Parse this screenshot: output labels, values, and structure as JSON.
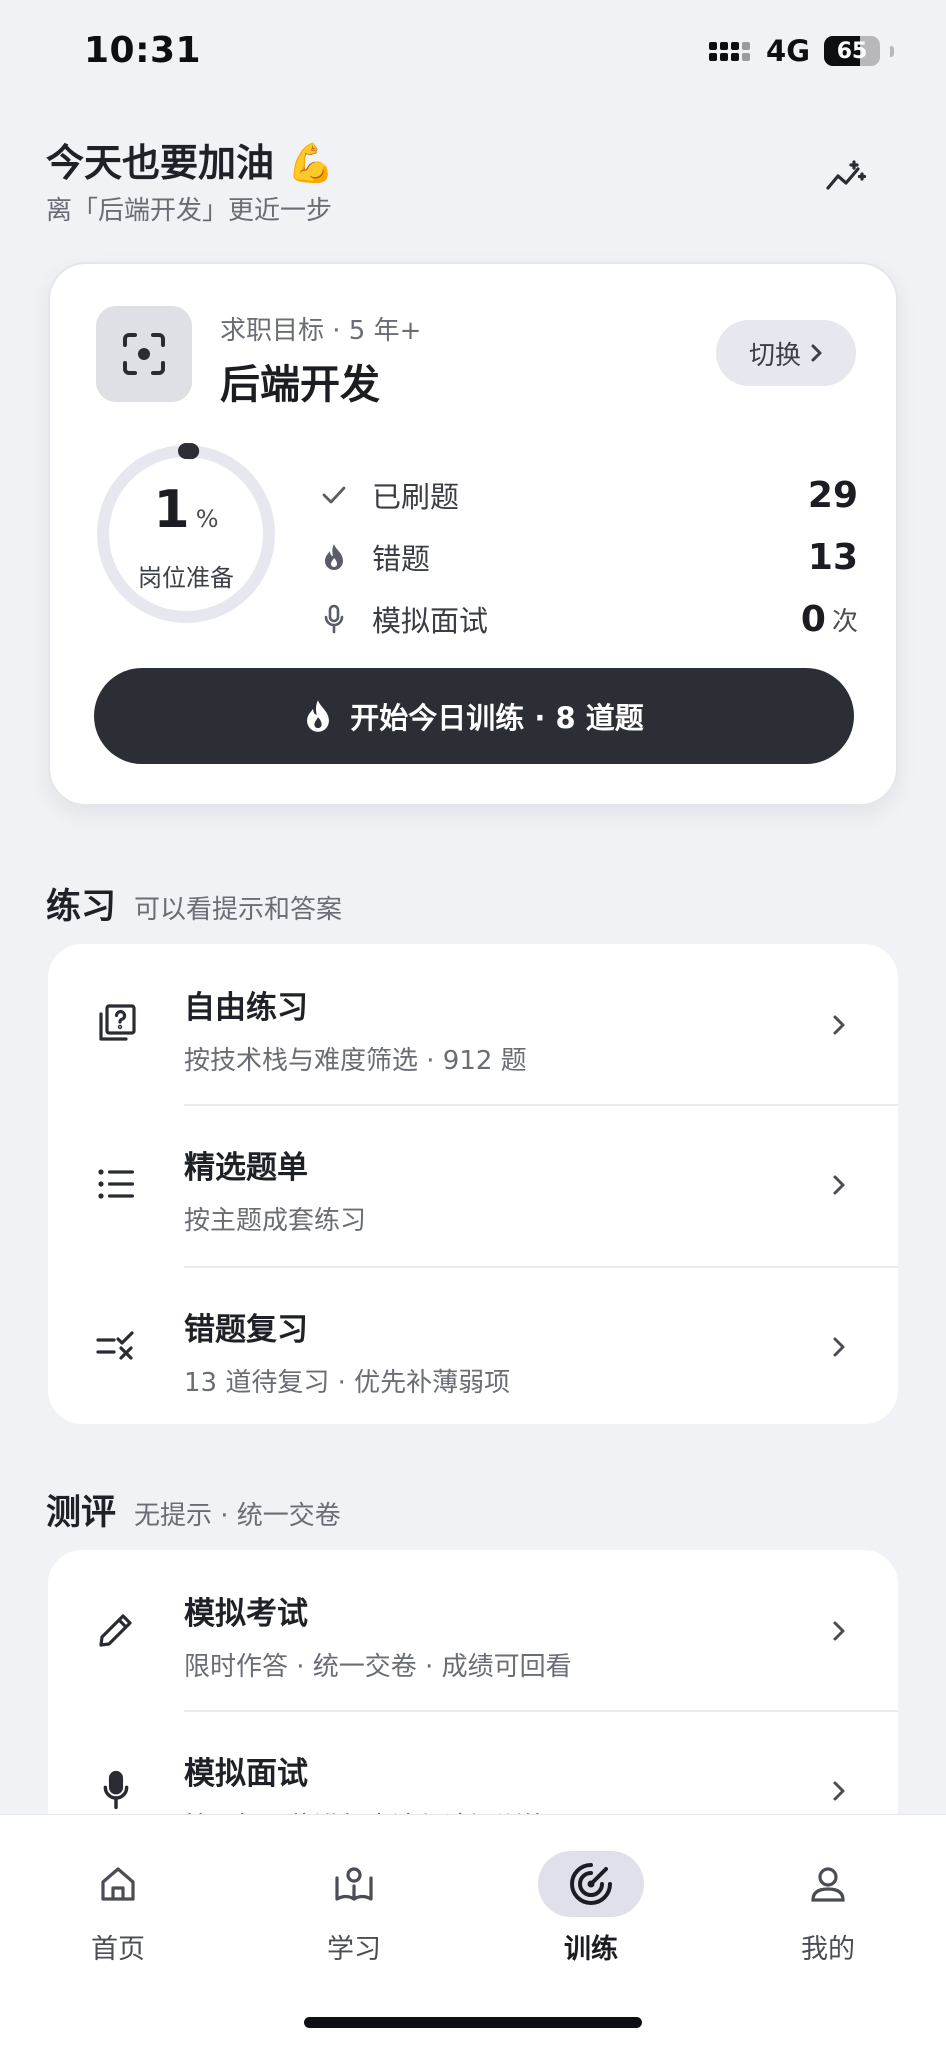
{
  "status_bar": {
    "time": "10:31",
    "network": "4G",
    "battery": "65"
  },
  "greeting": {
    "title": "今天也要加油 💪",
    "subtitle": "离「后端开发」更近一步"
  },
  "goal_card": {
    "meta": "求职目标 · 5 年+",
    "name": "后端开发",
    "switch_label": "切换",
    "progress": {
      "percent": 1,
      "value": "1",
      "unit": "%",
      "label": "岗位准备"
    },
    "stats": [
      {
        "label": "已刷题",
        "value": "29",
        "suffix": "",
        "icon": "check-icon"
      },
      {
        "label": "错题",
        "value": "13",
        "suffix": "",
        "icon": "flame-icon"
      },
      {
        "label": "模拟面试",
        "value": "0",
        "suffix": "次",
        "icon": "mic-icon"
      }
    ],
    "start_button": "开始今日训练 · 8 道题"
  },
  "practice": {
    "title": "练习",
    "subtitle": "可以看提示和答案",
    "items": [
      {
        "title": "自由练习",
        "subtitle": "按技术栈与难度筛选 · 912 题",
        "icon": "question-stack-icon"
      },
      {
        "title": "精选题单",
        "subtitle": "按主题成套练习",
        "icon": "list-icon"
      },
      {
        "title": "错题复习",
        "subtitle": "13 道待复习 · 优先补薄弱项",
        "icon": "check-cross-list-icon"
      }
    ]
  },
  "assessment": {
    "title": "测评",
    "subtitle": "无提示 · 统一交卷",
    "items": [
      {
        "title": "模拟考试",
        "subtitle": "限时作答 · 统一交卷 · 成绩可回看",
        "icon": "pencil-icon"
      },
      {
        "title": "模拟面试",
        "subtitle": "按目标职位进行表达与追问训练",
        "icon": "mic-icon"
      }
    ]
  },
  "bottom_nav": {
    "tabs": [
      {
        "label": "首页",
        "icon": "home-icon",
        "active": false
      },
      {
        "label": "学习",
        "icon": "book-icon",
        "active": false
      },
      {
        "label": "训练",
        "icon": "target-icon",
        "active": true
      },
      {
        "label": "我的",
        "icon": "profile-icon",
        "active": false
      }
    ]
  },
  "colors": {
    "background": "#f1f2f6",
    "primary_dark": "#2c2e36",
    "accent_soft": "#dfe0ea"
  }
}
